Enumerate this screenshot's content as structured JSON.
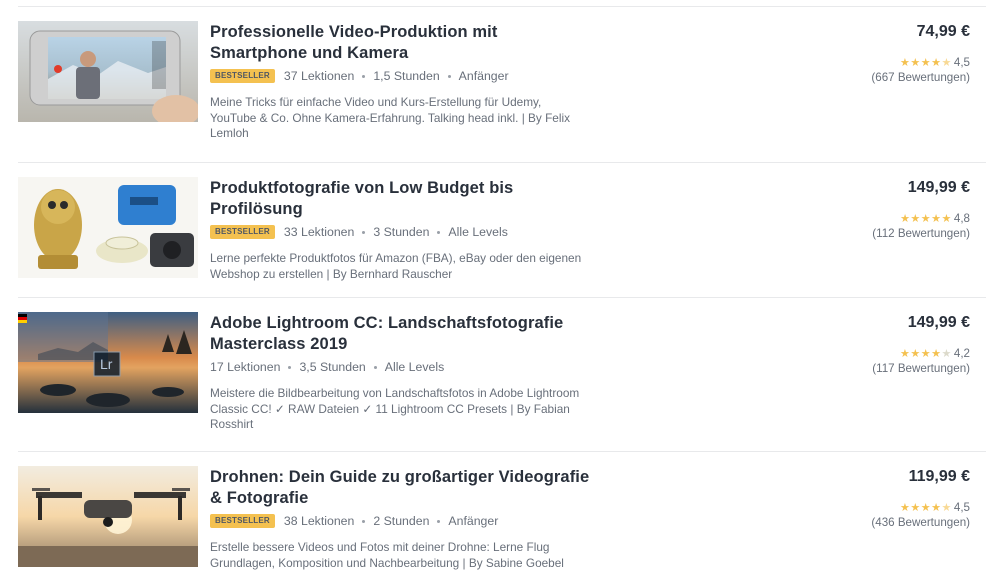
{
  "courses": [
    {
      "title": "Professionelle Video-Produktion mit Smartphone und Kamera",
      "badge": "BESTSELLER",
      "lectures": "37 Lektionen",
      "duration": "1,5 Stunden",
      "level": "Anfänger",
      "description": "Meine Tricks für einfache Video und Kurs-Erstellung für Udemy, YouTube & Co. Ohne Kamera-Erfahrung. Talking head inkl. | By Felix Lemloh",
      "price": "74,99 €",
      "rating_stars": "★★★★",
      "rating_half": "★",
      "rating_empty": "",
      "rating": "4,5",
      "reviews": "(667 Bewertungen)"
    },
    {
      "title": "Produktfotografie von Low Budget bis Profilösung",
      "badge": "BESTSELLER",
      "lectures": "33 Lektionen",
      "duration": "3 Stunden",
      "level": "Alle Levels",
      "description": "Lerne perfekte Produktfotos für Amazon (FBA), eBay oder den eigenen Webshop zu erstellen | By Bernhard Rauscher",
      "price": "149,99 €",
      "rating_stars": "★★★★★",
      "rating_half": "",
      "rating_empty": "",
      "rating": "4,8",
      "reviews": "(112 Bewertungen)"
    },
    {
      "title": "Adobe Lightroom CC: Landschaftsfotografie Masterclass 2019",
      "badge": "",
      "lectures": "17 Lektionen",
      "duration": "3,5 Stunden",
      "level": "Alle Levels",
      "description": "Meistere die Bildbearbeitung von Landschaftsfotos in Adobe Lightroom Classic CC! ✓ RAW Dateien ✓ 11 Lightroom CC Presets | By Fabian Rosshirt",
      "price": "149,99 €",
      "rating_stars": "★★★★",
      "rating_half": "",
      "rating_empty": "★",
      "rating": "4,2",
      "reviews": "(117 Bewertungen)",
      "thumb_label": "Lr"
    },
    {
      "title": "Drohnen: Dein Guide zu großartiger Videografie & Fotografie",
      "badge": "BESTSELLER",
      "lectures": "38 Lektionen",
      "duration": "2 Stunden",
      "level": "Anfänger",
      "description": "Erstelle bessere Videos und Fotos mit deiner Drohne: Lerne Flug Grundlagen, Komposition und Nachbearbeitung | By Sabine Goebel",
      "price": "119,99 €",
      "rating_stars": "★★★★",
      "rating_half": "★",
      "rating_empty": "",
      "rating": "4,5",
      "reviews": "(436 Bewertungen)"
    }
  ],
  "colors": {
    "badge": "#f4c150",
    "star": "#f4c150",
    "text": "#29303b",
    "muted": "#686f7a"
  }
}
